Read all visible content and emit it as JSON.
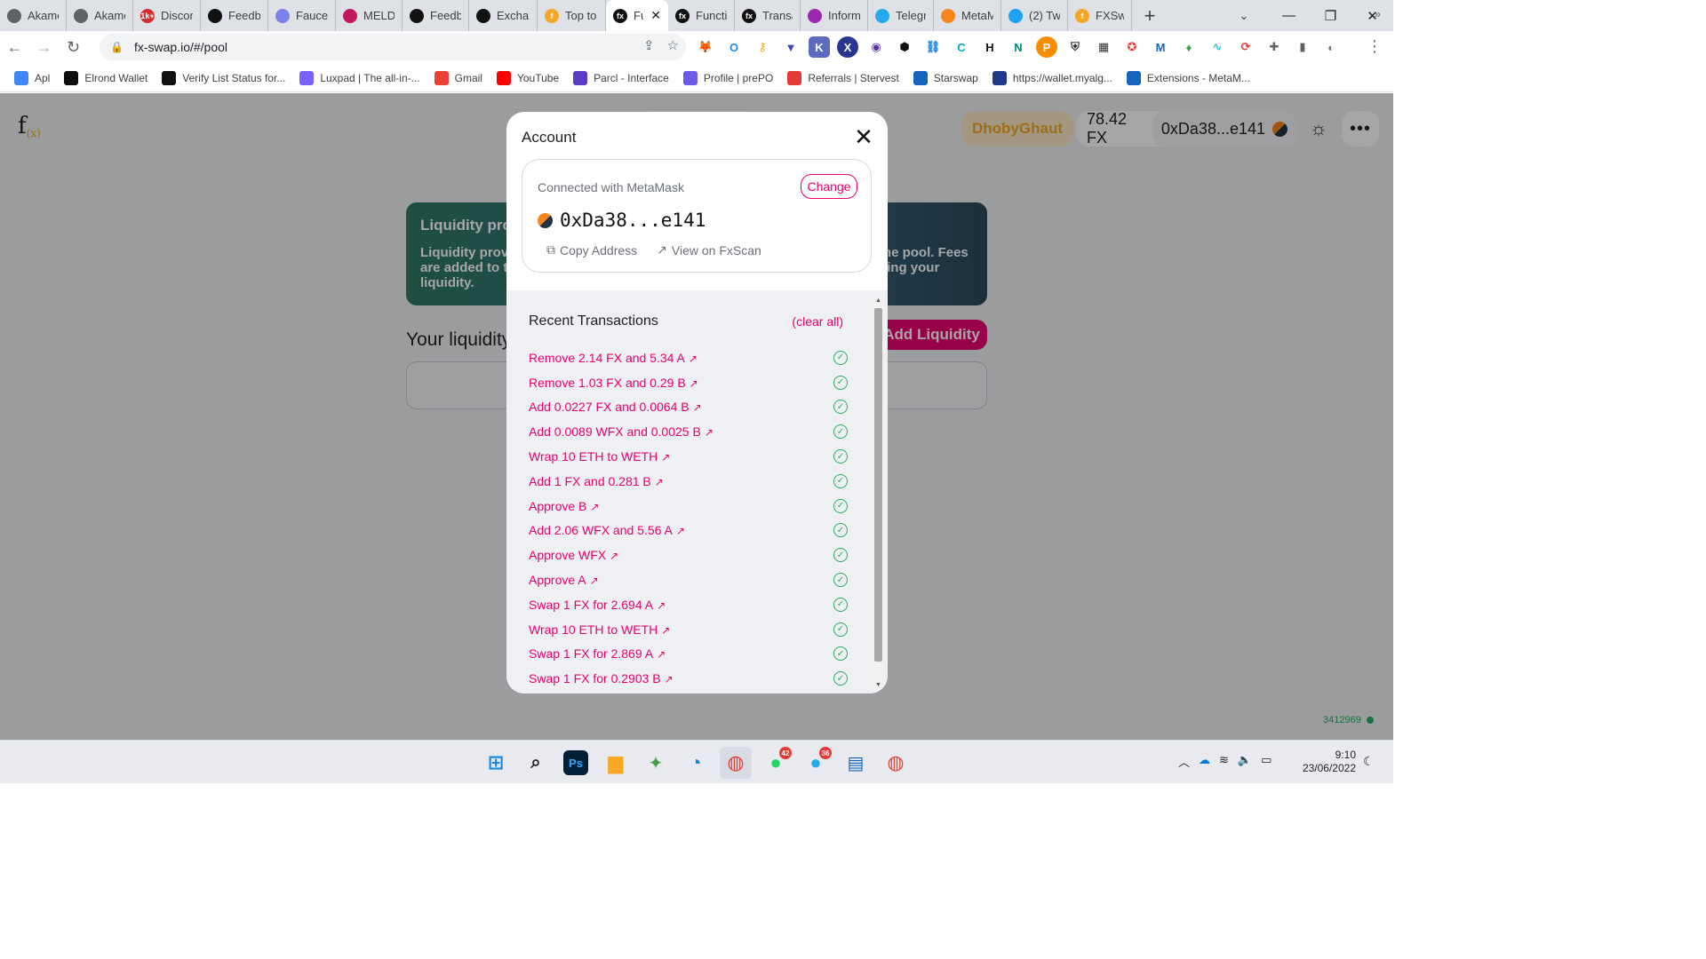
{
  "browser": {
    "tabs": [
      {
        "title": "Akamo",
        "fav_color": "#5f6368",
        "fav_text": ""
      },
      {
        "title": "Akamo",
        "fav_color": "#5f6368",
        "fav_text": ""
      },
      {
        "title": "Discor",
        "fav_color": "#d32f2f",
        "fav_text": "1k+"
      },
      {
        "title": "Feedb",
        "fav_color": "#111111",
        "fav_text": ""
      },
      {
        "title": "Faucet",
        "fav_color": "#7b83eb",
        "fav_text": ""
      },
      {
        "title": "MELD",
        "fav_color": "#c2185b",
        "fav_text": ""
      },
      {
        "title": "Feedb",
        "fav_color": "#111111",
        "fav_text": ""
      },
      {
        "title": "Exchar",
        "fav_color": "#111111",
        "fav_text": ""
      },
      {
        "title": "Top to",
        "fav_color": "#f5a623",
        "fav_text": "f"
      },
      {
        "title": "Fu",
        "fav_color": "#111111",
        "fav_text": "fx",
        "active": true
      },
      {
        "title": "Functi",
        "fav_color": "#111111",
        "fav_text": "fx"
      },
      {
        "title": "Transa",
        "fav_color": "#111111",
        "fav_text": "fx"
      },
      {
        "title": "Inform",
        "fav_color": "#9c27b0",
        "fav_text": ""
      },
      {
        "title": "Telegr",
        "fav_color": "#29a9eb",
        "fav_text": ""
      },
      {
        "title": "MetaM",
        "fav_color": "#f6851b",
        "fav_text": ""
      },
      {
        "title": "(2) Tw",
        "fav_color": "#1da1f2",
        "fav_text": ""
      },
      {
        "title": "FXSwa",
        "fav_color": "#f5a623",
        "fav_text": "f"
      }
    ],
    "url": "fx-swap.io/#/pool",
    "bookmarks": [
      {
        "label": "Apl",
        "color": "#4285f4"
      },
      {
        "label": "Elrond Wallet",
        "color": "#111111"
      },
      {
        "label": "Verify List Status for...",
        "color": "#111111"
      },
      {
        "label": "Luxpad | The all-in-...",
        "color": "#7b61ff"
      },
      {
        "label": "Gmail",
        "color": "#ea4335"
      },
      {
        "label": "YouTube",
        "color": "#ff0000"
      },
      {
        "label": "Parcl - Interface",
        "color": "#5b3cc4"
      },
      {
        "label": "Profile | prePO",
        "color": "#6c5ce7"
      },
      {
        "label": "Referrals | Stervest",
        "color": "#e53935"
      },
      {
        "label": "Starswap",
        "color": "#1565c0"
      },
      {
        "label": "https://wallet.myalg...",
        "color": "#1e3a8a"
      },
      {
        "label": "Extensions - MetaM...",
        "color": "#1565c0"
      }
    ]
  },
  "app": {
    "logo": "f",
    "logo_sup": "(x)",
    "user_name": "DhobyGhaut",
    "balance": "78.42 FX",
    "address_short": "0xDa38...e141",
    "info_title": "Liquidity provider rewards",
    "info_text": "Liquidity providers earn a fee on all trades proportional to their share of the pool. Fees are added to the pool, accrue in real time and can be claimed by withdrawing your liquidity.",
    "your_liquidity": "Your liquidity",
    "add_liquidity": "Add Liquidity",
    "block_number": "3412969"
  },
  "modal": {
    "title": "Account",
    "connected_with": "Connected with MetaMask",
    "change": "Change",
    "address": "0xDa38...e141",
    "copy_address": "Copy Address",
    "view_on_explorer": "View on FxScan",
    "recent_title": "Recent Transactions",
    "clear_all": "(clear all)",
    "transactions": [
      "Remove 2.14 FX and 5.34 A",
      "Remove 1.03 FX and 0.29 B",
      "Add 0.0227 FX and 0.0064 B",
      "Add 0.0089 WFX and 0.0025 B",
      "Wrap 10 ETH to WETH",
      "Add 1 FX and 0.281 B",
      "Approve B",
      "Add 2.06 WFX and 5.56 A",
      "Approve WFX",
      "Approve A",
      "Swap 1 FX for 2.694 A",
      "Wrap 10 ETH to WETH",
      "Swap 1 FX for 2.869 A",
      "Swap 1 FX for 0.2903 B"
    ]
  },
  "taskbar": {
    "time": "9:10",
    "date": "23/06/2022",
    "whatsapp_badge": "42",
    "telegram_badge": "36"
  },
  "colors": {
    "accent": "#e8006f",
    "success": "#27ae60",
    "user": "#f5a623"
  }
}
